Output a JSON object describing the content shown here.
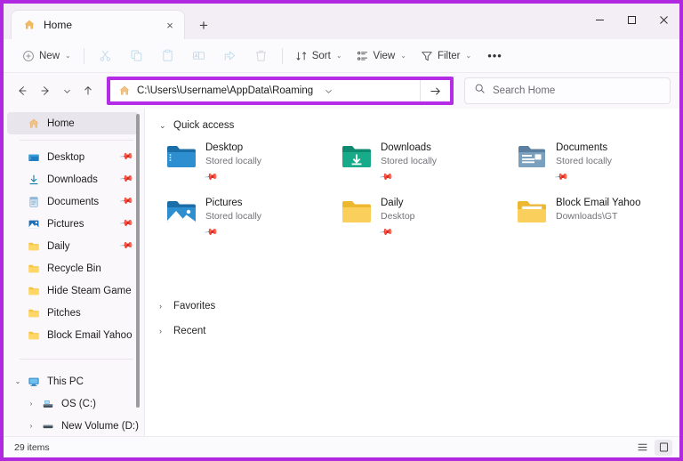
{
  "window": {
    "tab_title": "Home",
    "tab_close_label": "×",
    "new_tab_label": "+",
    "minimize_label": "minimize-icon",
    "maximize_label": "maximize-icon",
    "close_label": "close-icon"
  },
  "toolbar": {
    "new_label": "New",
    "new_chevron": "⌄",
    "cut_label": "cut-icon",
    "copy_label": "copy-icon",
    "paste_label": "paste-icon",
    "rename_label": "rename-icon",
    "share_label": "share-icon",
    "delete_label": "delete-icon",
    "sort_label": "Sort",
    "sort_chevron": "⌄",
    "view_label": "View",
    "view_chevron": "⌄",
    "filter_label": "Filter",
    "filter_chevron": "⌄",
    "more_label": "•••"
  },
  "navigation": {
    "back_label": "back-arrow-icon",
    "forward_label": "forward-arrow-icon",
    "recent_label": "⌄",
    "up_label": "up-arrow-icon"
  },
  "address_bar": {
    "path": "C:\\Users\\Username\\AppData\\Roaming",
    "dropdown_label": "⌄",
    "go_label": "go-arrow-icon",
    "highlight_color": "#b52ce6"
  },
  "search": {
    "placeholder": "Search Home",
    "icon": "search-icon"
  },
  "sidebar": {
    "home": {
      "label": "Home",
      "icon": "home-icon",
      "selected": true
    },
    "pinned": [
      {
        "label": "Desktop",
        "icon": "desktop-folder-icon",
        "pinned": true
      },
      {
        "label": "Downloads",
        "icon": "downloads-icon",
        "pinned": true
      },
      {
        "label": "Documents",
        "icon": "documents-icon",
        "pinned": true
      },
      {
        "label": "Pictures",
        "icon": "pictures-icon",
        "pinned": true
      },
      {
        "label": "Daily",
        "icon": "folder-icon",
        "pinned": true
      },
      {
        "label": "Recycle Bin",
        "icon": "folder-icon",
        "pinned": false
      },
      {
        "label": "Hide Steam Game",
        "icon": "folder-icon",
        "pinned": false
      },
      {
        "label": "Pitches",
        "icon": "folder-icon",
        "pinned": false
      },
      {
        "label": "Block Email Yahoo",
        "icon": "folder-icon",
        "pinned": false
      }
    ],
    "this_pc": {
      "label": "This PC",
      "icon": "this-pc-icon",
      "caret": "⌄",
      "drives": [
        {
          "label": "OS (C:)",
          "icon": "os-drive-icon",
          "caret": "›"
        },
        {
          "label": "New Volume (D:)",
          "icon": "drive-icon",
          "caret": "›"
        }
      ]
    }
  },
  "content": {
    "quick_access": {
      "label": "Quick access",
      "caret": "⌄",
      "items": [
        {
          "name": "Desktop",
          "sub": "Stored locally",
          "icon": "desktop-folder-icon",
          "pinned": true
        },
        {
          "name": "Downloads",
          "sub": "Stored locally",
          "icon": "downloads-folder-icon",
          "pinned": true
        },
        {
          "name": "Documents",
          "sub": "Stored locally",
          "icon": "documents-folder-icon",
          "pinned": true
        },
        {
          "name": "Pictures",
          "sub": "Stored locally",
          "icon": "pictures-folder-icon",
          "pinned": true
        },
        {
          "name": "Daily",
          "sub": "Desktop",
          "icon": "folder-icon",
          "pinned": true
        },
        {
          "name": "Block Email Yahoo",
          "sub": "Downloads\\GT",
          "icon": "folder-open-icon",
          "pinned": false
        }
      ]
    },
    "favorites": {
      "label": "Favorites",
      "caret": "›"
    },
    "recent": {
      "label": "Recent",
      "caret": "›"
    }
  },
  "status": {
    "item_count": "29 items",
    "list_view_label": "list-view-icon",
    "details_view_label": "details-view-icon"
  }
}
